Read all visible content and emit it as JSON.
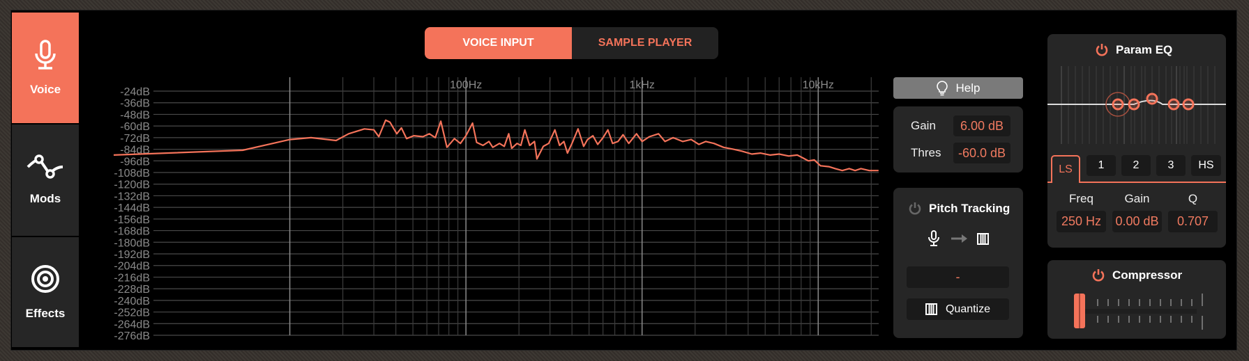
{
  "colors": {
    "accent": "#f4735a",
    "panel": "#262626",
    "value_text": "#f07a60"
  },
  "sidebar": {
    "items": [
      {
        "label": "Voice",
        "icon": "microphone-icon",
        "active": true
      },
      {
        "label": "Mods",
        "icon": "modulation-curve-icon",
        "active": false
      },
      {
        "label": "Effects",
        "icon": "target-icon",
        "active": false
      }
    ]
  },
  "source_toggle": {
    "options": [
      "VOICE INPUT",
      "SAMPLE PLAYER"
    ],
    "selected": "VOICE INPUT"
  },
  "chart_data": {
    "type": "line",
    "x_scale": "log",
    "xlim": [
      1,
      22050
    ],
    "ylim": [
      -276,
      -24
    ],
    "x_tick_labels": [
      {
        "value": 100,
        "label": "100Hz"
      },
      {
        "value": 1000,
        "label": "1kHz"
      },
      {
        "value": 10000,
        "label": "10kHz"
      }
    ],
    "y_ticks": [
      -24,
      -36,
      -48,
      -60,
      -72,
      -84,
      -96,
      -108,
      -120,
      -132,
      -144,
      -156,
      -168,
      -180,
      -192,
      -204,
      -216,
      -228,
      -240,
      -252,
      -264,
      -276
    ],
    "y_tick_suffix": "dB",
    "grid": true,
    "series": [
      {
        "color": "#f4735a",
        "points": [
          [
            1,
            -90
          ],
          [
            5.4,
            -85
          ],
          [
            10,
            -74
          ],
          [
            13.2,
            -72
          ],
          [
            18.3,
            -75
          ],
          [
            21.6,
            -68
          ],
          [
            26.5,
            -63
          ],
          [
            30,
            -64
          ],
          [
            32,
            -71
          ],
          [
            35,
            -54
          ],
          [
            37,
            -56
          ],
          [
            40.5,
            -68
          ],
          [
            43,
            -62
          ],
          [
            46,
            -73
          ],
          [
            50.6,
            -70
          ],
          [
            57,
            -71
          ],
          [
            62,
            -68
          ],
          [
            67,
            -72
          ],
          [
            72,
            -55
          ],
          [
            78,
            -82
          ],
          [
            86,
            -73
          ],
          [
            93,
            -78
          ],
          [
            100,
            -70
          ],
          [
            109,
            -57
          ],
          [
            115,
            -77
          ],
          [
            125,
            -80
          ],
          [
            135,
            -76
          ],
          [
            142,
            -82
          ],
          [
            155,
            -78
          ],
          [
            165,
            -81
          ],
          [
            175,
            -68
          ],
          [
            182,
            -83
          ],
          [
            195,
            -78
          ],
          [
            205,
            -80
          ],
          [
            216,
            -64
          ],
          [
            230,
            -80
          ],
          [
            245,
            -76
          ],
          [
            253,
            -94
          ],
          [
            275,
            -81
          ],
          [
            295,
            -78
          ],
          [
            320,
            -64
          ],
          [
            340,
            -80
          ],
          [
            360,
            -76
          ],
          [
            377,
            -88
          ],
          [
            400,
            -78
          ],
          [
            433,
            -63
          ],
          [
            466,
            -81
          ],
          [
            490,
            -74
          ],
          [
            526,
            -70
          ],
          [
            560,
            -79
          ],
          [
            600,
            -72
          ],
          [
            640,
            -64
          ],
          [
            680,
            -78
          ],
          [
            730,
            -76
          ],
          [
            780,
            -69
          ],
          [
            840,
            -78
          ],
          [
            930,
            -68
          ],
          [
            1000,
            -76
          ],
          [
            1100,
            -71
          ],
          [
            1240,
            -68
          ],
          [
            1350,
            -76
          ],
          [
            1500,
            -72
          ],
          [
            1700,
            -76
          ],
          [
            1900,
            -74
          ],
          [
            2100,
            -79
          ],
          [
            2300,
            -76
          ],
          [
            2560,
            -78
          ],
          [
            2900,
            -82
          ],
          [
            3300,
            -84
          ],
          [
            3700,
            -86
          ],
          [
            4200,
            -89
          ],
          [
            4700,
            -88
          ],
          [
            5340,
            -90
          ],
          [
            6000,
            -89
          ],
          [
            6800,
            -91
          ],
          [
            7600,
            -90
          ],
          [
            8200,
            -93
          ],
          [
            8800,
            -96
          ],
          [
            9500,
            -95
          ],
          [
            10300,
            -101
          ],
          [
            11500,
            -102
          ],
          [
            12500,
            -104
          ],
          [
            13700,
            -106
          ],
          [
            15000,
            -104
          ],
          [
            16200,
            -106
          ],
          [
            17500,
            -104
          ],
          [
            19500,
            -106
          ],
          [
            22000,
            -106
          ]
        ]
      }
    ]
  },
  "help": {
    "label": "Help",
    "icon": "lightbulb-icon"
  },
  "input_params": {
    "gain_label": "Gain",
    "gain_value": "6.00 dB",
    "thres_label": "Thres",
    "thres_value": "-60.0 dB"
  },
  "pitch_tracking": {
    "title": "Pitch Tracking",
    "enabled": false,
    "note_value": "-",
    "quantize_label": "Quantize"
  },
  "param_eq": {
    "title": "Param EQ",
    "enabled": true,
    "bands": [
      "LS",
      "1",
      "2",
      "3",
      "HS"
    ],
    "selected_band": "LS",
    "freq_label": "Freq",
    "gain_label": "Gain",
    "q_label": "Q",
    "freq_value": "250 Hz",
    "gain_value": "0.00 dB",
    "q_value": "0.707"
  },
  "compressor": {
    "title": "Compressor",
    "enabled": true,
    "amount": 0
  }
}
